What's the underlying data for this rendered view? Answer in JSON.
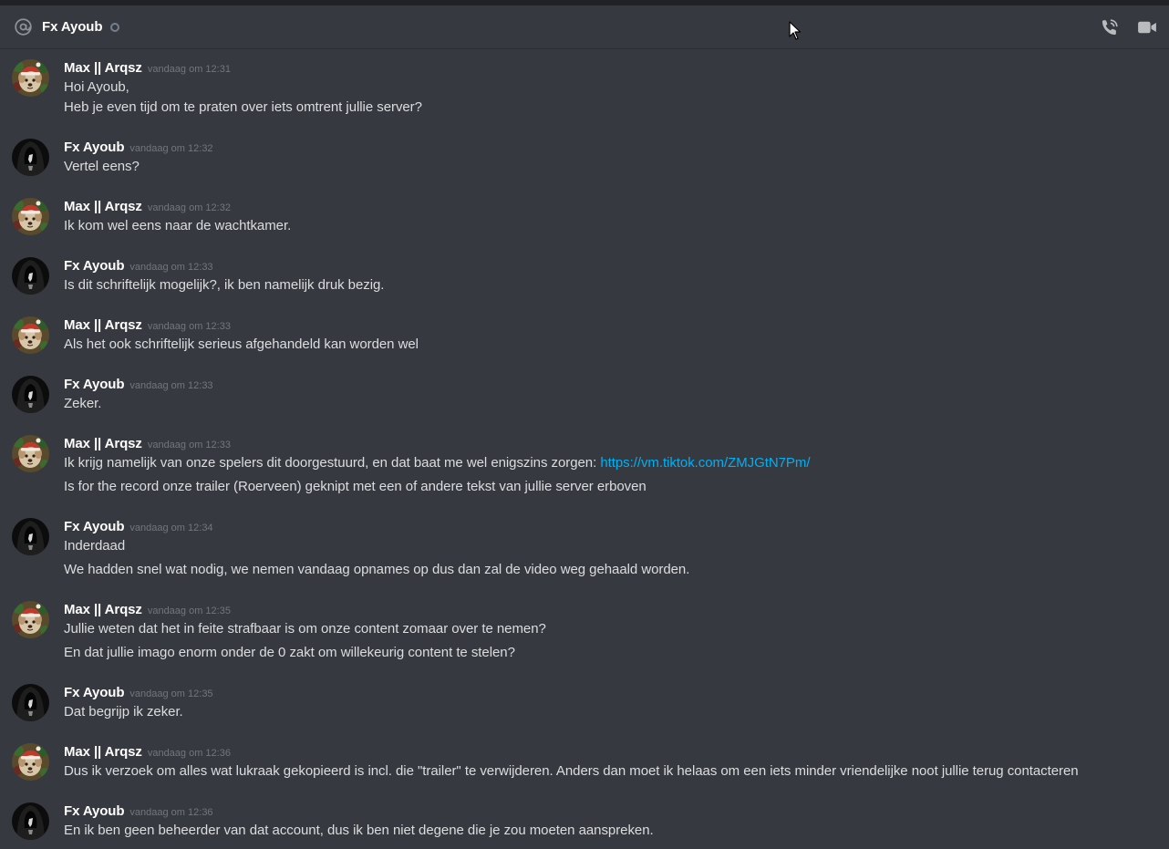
{
  "header": {
    "title": "Fx Ayoub",
    "status": "offline"
  },
  "colors": {
    "background": "#36393f",
    "link": "#00b0f4",
    "timestamp": "#72767d",
    "text": "#dcddde"
  },
  "icons": {
    "header_left": "at-icon",
    "call": "phone-call-icon",
    "video": "video-camera-icon"
  },
  "messages": [
    {
      "author": "Max || Arqsz",
      "avatar": "christmas-dog-avatar",
      "timestamp": "vandaag om 12:31",
      "lines": [
        "Hoi Ayoub,",
        "Heb je even tijd om te praten over iets omtrent jullie server?"
      ]
    },
    {
      "author": "Fx Ayoub",
      "avatar": "hooded-figure-avatar",
      "timestamp": "vandaag om 12:32",
      "lines": [
        "Vertel eens?"
      ]
    },
    {
      "author": "Max || Arqsz",
      "avatar": "christmas-dog-avatar",
      "timestamp": "vandaag om 12:32",
      "lines": [
        "Ik kom wel eens naar de wachtkamer."
      ]
    },
    {
      "author": "Fx Ayoub",
      "avatar": "hooded-figure-avatar",
      "timestamp": "vandaag om 12:33",
      "lines": [
        "Is dit schriftelijk mogelijk?, ik ben namelijk druk bezig."
      ]
    },
    {
      "author": "Max || Arqsz",
      "avatar": "christmas-dog-avatar",
      "timestamp": "vandaag om 12:33",
      "lines": [
        "Als het ook schriftelijk serieus afgehandeld kan worden wel"
      ]
    },
    {
      "author": "Fx Ayoub",
      "avatar": "hooded-figure-avatar",
      "timestamp": "vandaag om 12:33",
      "lines": [
        "Zeker."
      ]
    },
    {
      "author": "Max || Arqsz",
      "avatar": "christmas-dog-avatar",
      "timestamp": "vandaag om 12:33",
      "line1_text": "Ik krijg namelijk van onze spelers dit doorgestuurd, en dat baat me wel enigszins zorgen: ",
      "line1_link": "https://vm.tiktok.com/ZMJGtN7Pm/",
      "lines": [
        "Is for the record onze trailer (Roerveen) geknipt met een of andere tekst van jullie server erboven"
      ]
    },
    {
      "author": "Fx Ayoub",
      "avatar": "hooded-figure-avatar",
      "timestamp": "vandaag om 12:34",
      "lines": [
        "Inderdaad",
        "We hadden snel wat nodig, we nemen vandaag opnames op dus dan zal de video weg gehaald worden."
      ]
    },
    {
      "author": "Max || Arqsz",
      "avatar": "christmas-dog-avatar",
      "timestamp": "vandaag om 12:35",
      "lines": [
        "Jullie weten dat het in feite strafbaar is om onze content zomaar over te nemen?",
        "En dat jullie imago enorm onder de 0 zakt om willekeurig content te stelen?"
      ]
    },
    {
      "author": "Fx Ayoub",
      "avatar": "hooded-figure-avatar",
      "timestamp": "vandaag om 12:35",
      "lines": [
        "Dat begrijp ik zeker."
      ]
    },
    {
      "author": "Max || Arqsz",
      "avatar": "christmas-dog-avatar",
      "timestamp": "vandaag om 12:36",
      "lines": [
        "Dus ik verzoek om alles wat lukraak gekopieerd is incl. die \"trailer\" te verwijderen. Anders dan moet ik helaas om een iets minder vriendelijke noot jullie terug contacteren"
      ]
    },
    {
      "author": "Fx Ayoub",
      "avatar": "hooded-figure-avatar",
      "timestamp": "vandaag om 12:36",
      "lines": [
        "En ik ben geen beheerder van dat account, dus ik ben niet degene die je zou moeten aanspreken."
      ]
    }
  ]
}
